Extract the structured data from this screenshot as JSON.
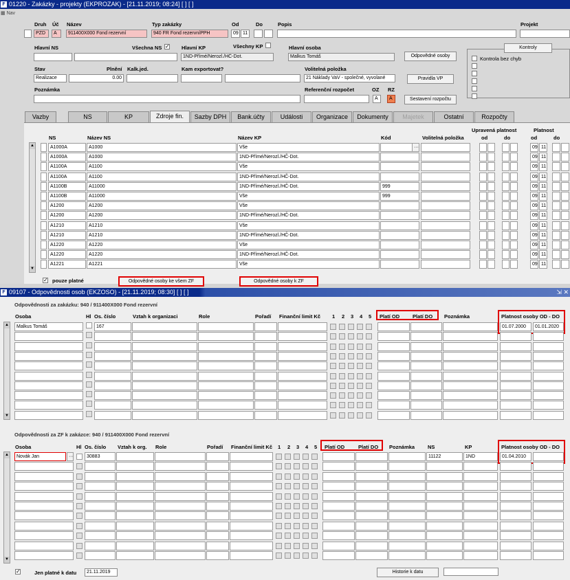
{
  "win1": {
    "title": "01220 - Zakázky - projekty (EKPROZAK) - [21.11.2019; 08:24]  [ ]  [ ]",
    "nav": "Nav",
    "labels": {
      "druh": "Druh",
      "uc": "Úč",
      "nazev": "Název",
      "typ": "Typ zakázky",
      "od": "Od",
      "do": "Do",
      "popis": "Popis",
      "projekt": "Projekt",
      "hlavni_ns": "Hlavní NS",
      "vsechna_ns": "Všechna NS",
      "hlavni_kp": "Hlavní KP",
      "vsechny_kp": "Všechny KP",
      "hlavni_osoba": "Hlavní osoba",
      "stav": "Stav",
      "plneni": "Plnění",
      "kalk": "Kalk.jed.",
      "kam": "Kam exportovat?",
      "volitelna": "Volitelná položka",
      "poznamka": "Poznámka",
      "ref": "Referenční rozpočet",
      "oz": "OZ",
      "rz": "RZ",
      "kontroly_chk": "Kontrola bez chyb"
    },
    "values": {
      "druh": "PZD",
      "uc": "A",
      "nazev": "911400X000 Fond rezervní",
      "typ": "940 FR Fond rezervníPPH",
      "od": "09",
      "od2": "11",
      "hlavni_kp": "1ND-Přímé/Nerozl./HČ-Dot.",
      "hlavni_osoba": "Malkus Tomáš",
      "stav": "Realizace",
      "plneni": "0.00",
      "volitelna": "21 Náklady VaV - společné, vyvolané",
      "oz": "A",
      "rz": "A"
    },
    "buttons": {
      "kontroly": "Kontroly",
      "odp_osoby": "Odpovědné osoby",
      "pravidla": "Pravidla VP",
      "sestaveni": "Sestavení rozpočtu"
    },
    "tabs": [
      {
        "label": "Vazby"
      },
      {
        "label": "NS"
      },
      {
        "label": "KP"
      },
      {
        "label": "Zdroje fin."
      },
      {
        "label": "Sazby DPH"
      },
      {
        "label": "Bank.účty"
      },
      {
        "label": "Události"
      },
      {
        "label": "Organizace"
      },
      {
        "label": "Dokumenty"
      },
      {
        "label": "Majetek"
      },
      {
        "label": "Ostatní"
      },
      {
        "label": "Rozpočty"
      }
    ],
    "grid": {
      "headers": {
        "ns": "NS",
        "nazev_ns": "Název NS",
        "nazev_kp": "Název KP",
        "kod": "Kód",
        "volitelna": "Volitelná položka",
        "upravena": "Upravená platnost",
        "platnost": "Platnost",
        "od": "od",
        "do": "do"
      },
      "rows": [
        {
          "ns": "A1000A",
          "nazev_ns": "A1000",
          "kp": "Vše",
          "kod": "",
          "od": "09",
          "do": "11"
        },
        {
          "ns": "A1000A",
          "nazev_ns": "A1000",
          "kp": "1ND-Přímé/Nerozl./HČ-Dot.",
          "kod": "",
          "od": "09",
          "do": "11"
        },
        {
          "ns": "A1100A",
          "nazev_ns": "A1100",
          "kp": "Vše",
          "kod": "",
          "od": "09",
          "do": "11"
        },
        {
          "ns": "A1100A",
          "nazev_ns": "A1100",
          "kp": "1ND-Přímé/Nerozl./HČ-Dot.",
          "kod": "",
          "od": "09",
          "do": "11"
        },
        {
          "ns": "A1100B",
          "nazev_ns": "A11000",
          "kp": "1ND-Přímé/Nerozl./HČ-Dot.",
          "kod": "999",
          "od": "09",
          "do": "11"
        },
        {
          "ns": "A1100B",
          "nazev_ns": "A11000",
          "kp": "Vše",
          "kod": "999",
          "od": "09",
          "do": "11"
        },
        {
          "ns": "A1200",
          "nazev_ns": "A1200",
          "kp": "Vše",
          "kod": "",
          "od": "09",
          "do": "11"
        },
        {
          "ns": "A1200",
          "nazev_ns": "A1200",
          "kp": "1ND-Přímé/Nerozl./HČ-Dot.",
          "kod": "",
          "od": "09",
          "do": "11"
        },
        {
          "ns": "A1210",
          "nazev_ns": "A1210",
          "kp": "Vše",
          "kod": "",
          "od": "09",
          "do": "11"
        },
        {
          "ns": "A1210",
          "nazev_ns": "A1210",
          "kp": "1ND-Přímé/Nerozl./HČ-Dot.",
          "kod": "",
          "od": "09",
          "do": "11"
        },
        {
          "ns": "A1220",
          "nazev_ns": "A1220",
          "kp": "Vše",
          "kod": "",
          "od": "09",
          "do": "11"
        },
        {
          "ns": "A1220",
          "nazev_ns": "A1220",
          "kp": "1ND-Přímé/Nerozl./HČ-Dot.",
          "kod": "",
          "od": "09",
          "do": "11"
        },
        {
          "ns": "A1221",
          "nazev_ns": "A1221",
          "kp": "Vše",
          "kod": "",
          "od": "09",
          "do": "11"
        }
      ]
    },
    "pouze": "pouze platné",
    "btn_vsem": "Odpovědné osoby ke všem ZF",
    "btn_zf": "Odpovědné osoby k ZF"
  },
  "win2": {
    "title": "09107 - Odpovědnosti osob (EKZOSO) - [21.11.2019; 08:30]  [ ]  [ ]",
    "sec1": "Odpovědnosti za zakázku: 940 / 911400X000 Fond rezervní",
    "sec2": "Odpovědnosti za ZF k zakázce: 940 / 911400X000 Fond rezervní",
    "h": {
      "osoba": "Osoba",
      "hl": "Hl",
      "cislo": "Os. číslo",
      "vztah": "Vztah k organizaci",
      "vztah2": "Vztah k org.",
      "role": "Role",
      "poradi": "Pořadí",
      "limit": "Finanční limit Kč",
      "n1": "1",
      "n2": "2",
      "n3": "3",
      "n4": "4",
      "n5": "5",
      "plati_od": "Platí OD",
      "plati_do": "Platí DO",
      "poznamka": "Poznámka",
      "platnost": "Platnost osoby OD - DO",
      "ns": "NS",
      "kp": "KP"
    },
    "row1": {
      "osoba": "Malkus Tomáš",
      "cislo": "167",
      "pod": "01.07.2000",
      "pdo": "01.01.2020"
    },
    "row2": {
      "osoba": "Novák Jan",
      "cislo": "30883",
      "ns": "11122",
      "kp": "1ND",
      "pod": "01.04.2010"
    },
    "jen": "Jen platné k datu",
    "datum": "21.11.2019",
    "historie": "Historie k datu"
  }
}
